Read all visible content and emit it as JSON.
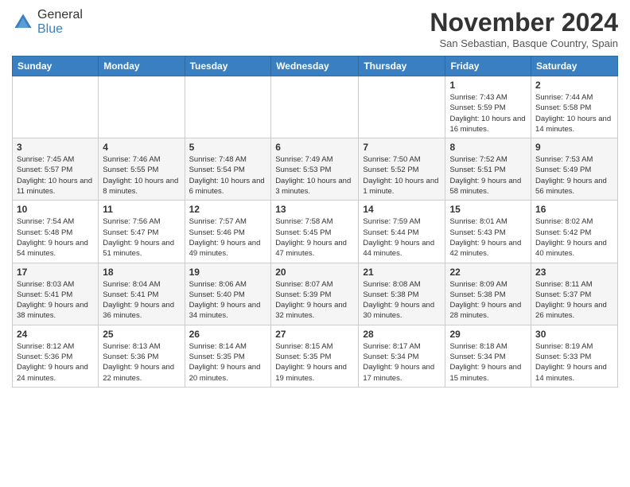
{
  "header": {
    "logo": {
      "general": "General",
      "blue": "Blue"
    },
    "title": "November 2024",
    "location": "San Sebastian, Basque Country, Spain"
  },
  "days_of_week": [
    "Sunday",
    "Monday",
    "Tuesday",
    "Wednesday",
    "Thursday",
    "Friday",
    "Saturday"
  ],
  "weeks": [
    [
      {
        "day": "",
        "info": ""
      },
      {
        "day": "",
        "info": ""
      },
      {
        "day": "",
        "info": ""
      },
      {
        "day": "",
        "info": ""
      },
      {
        "day": "",
        "info": ""
      },
      {
        "day": "1",
        "info": "Sunrise: 7:43 AM\nSunset: 5:59 PM\nDaylight: 10 hours and 16 minutes."
      },
      {
        "day": "2",
        "info": "Sunrise: 7:44 AM\nSunset: 5:58 PM\nDaylight: 10 hours and 14 minutes."
      }
    ],
    [
      {
        "day": "3",
        "info": "Sunrise: 7:45 AM\nSunset: 5:57 PM\nDaylight: 10 hours and 11 minutes."
      },
      {
        "day": "4",
        "info": "Sunrise: 7:46 AM\nSunset: 5:55 PM\nDaylight: 10 hours and 8 minutes."
      },
      {
        "day": "5",
        "info": "Sunrise: 7:48 AM\nSunset: 5:54 PM\nDaylight: 10 hours and 6 minutes."
      },
      {
        "day": "6",
        "info": "Sunrise: 7:49 AM\nSunset: 5:53 PM\nDaylight: 10 hours and 3 minutes."
      },
      {
        "day": "7",
        "info": "Sunrise: 7:50 AM\nSunset: 5:52 PM\nDaylight: 10 hours and 1 minute."
      },
      {
        "day": "8",
        "info": "Sunrise: 7:52 AM\nSunset: 5:51 PM\nDaylight: 9 hours and 58 minutes."
      },
      {
        "day": "9",
        "info": "Sunrise: 7:53 AM\nSunset: 5:49 PM\nDaylight: 9 hours and 56 minutes."
      }
    ],
    [
      {
        "day": "10",
        "info": "Sunrise: 7:54 AM\nSunset: 5:48 PM\nDaylight: 9 hours and 54 minutes."
      },
      {
        "day": "11",
        "info": "Sunrise: 7:56 AM\nSunset: 5:47 PM\nDaylight: 9 hours and 51 minutes."
      },
      {
        "day": "12",
        "info": "Sunrise: 7:57 AM\nSunset: 5:46 PM\nDaylight: 9 hours and 49 minutes."
      },
      {
        "day": "13",
        "info": "Sunrise: 7:58 AM\nSunset: 5:45 PM\nDaylight: 9 hours and 47 minutes."
      },
      {
        "day": "14",
        "info": "Sunrise: 7:59 AM\nSunset: 5:44 PM\nDaylight: 9 hours and 44 minutes."
      },
      {
        "day": "15",
        "info": "Sunrise: 8:01 AM\nSunset: 5:43 PM\nDaylight: 9 hours and 42 minutes."
      },
      {
        "day": "16",
        "info": "Sunrise: 8:02 AM\nSunset: 5:42 PM\nDaylight: 9 hours and 40 minutes."
      }
    ],
    [
      {
        "day": "17",
        "info": "Sunrise: 8:03 AM\nSunset: 5:41 PM\nDaylight: 9 hours and 38 minutes."
      },
      {
        "day": "18",
        "info": "Sunrise: 8:04 AM\nSunset: 5:41 PM\nDaylight: 9 hours and 36 minutes."
      },
      {
        "day": "19",
        "info": "Sunrise: 8:06 AM\nSunset: 5:40 PM\nDaylight: 9 hours and 34 minutes."
      },
      {
        "day": "20",
        "info": "Sunrise: 8:07 AM\nSunset: 5:39 PM\nDaylight: 9 hours and 32 minutes."
      },
      {
        "day": "21",
        "info": "Sunrise: 8:08 AM\nSunset: 5:38 PM\nDaylight: 9 hours and 30 minutes."
      },
      {
        "day": "22",
        "info": "Sunrise: 8:09 AM\nSunset: 5:38 PM\nDaylight: 9 hours and 28 minutes."
      },
      {
        "day": "23",
        "info": "Sunrise: 8:11 AM\nSunset: 5:37 PM\nDaylight: 9 hours and 26 minutes."
      }
    ],
    [
      {
        "day": "24",
        "info": "Sunrise: 8:12 AM\nSunset: 5:36 PM\nDaylight: 9 hours and 24 minutes."
      },
      {
        "day": "25",
        "info": "Sunrise: 8:13 AM\nSunset: 5:36 PM\nDaylight: 9 hours and 22 minutes."
      },
      {
        "day": "26",
        "info": "Sunrise: 8:14 AM\nSunset: 5:35 PM\nDaylight: 9 hours and 20 minutes."
      },
      {
        "day": "27",
        "info": "Sunrise: 8:15 AM\nSunset: 5:35 PM\nDaylight: 9 hours and 19 minutes."
      },
      {
        "day": "28",
        "info": "Sunrise: 8:17 AM\nSunset: 5:34 PM\nDaylight: 9 hours and 17 minutes."
      },
      {
        "day": "29",
        "info": "Sunrise: 8:18 AM\nSunset: 5:34 PM\nDaylight: 9 hours and 15 minutes."
      },
      {
        "day": "30",
        "info": "Sunrise: 8:19 AM\nSunset: 5:33 PM\nDaylight: 9 hours and 14 minutes."
      }
    ]
  ]
}
